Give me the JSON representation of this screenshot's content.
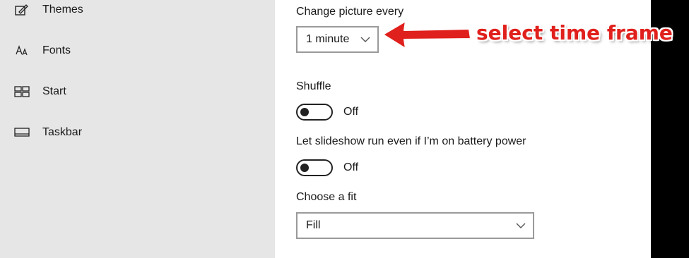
{
  "sidebar": {
    "items": [
      {
        "label": "Themes",
        "icon": "themes-icon"
      },
      {
        "label": "Fonts",
        "icon": "fonts-icon"
      },
      {
        "label": "Start",
        "icon": "start-icon"
      },
      {
        "label": "Taskbar",
        "icon": "taskbar-icon"
      }
    ]
  },
  "settings": {
    "change_picture_label": "Change picture every",
    "change_picture_value": "1 minute",
    "shuffle_label": "Shuffle",
    "shuffle_state": "Off",
    "battery_label": "Let slideshow run even if I’m on battery power",
    "battery_state": "Off",
    "fit_label": "Choose a fit",
    "fit_value": "Fill"
  },
  "annotation": {
    "text": "select time frame",
    "color": "#e0201c"
  },
  "colors": {
    "sidebar_bg": "#e6e6e6",
    "content_bg": "#ffffff",
    "accent_red": "#e0201c"
  }
}
